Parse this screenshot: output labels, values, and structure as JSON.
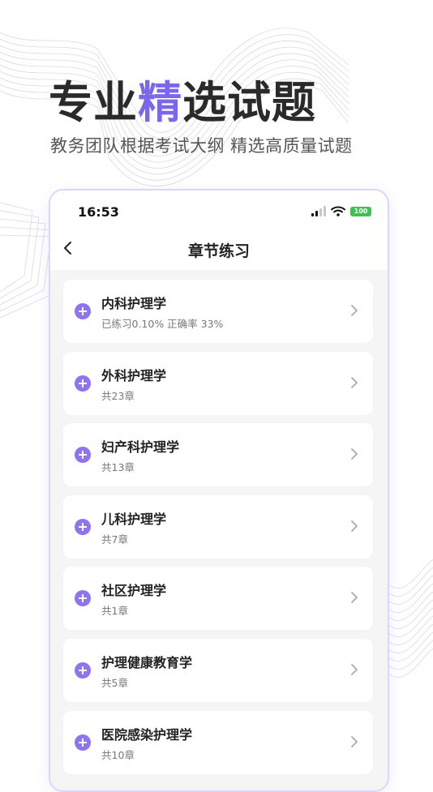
{
  "promo": {
    "title_part1": "专业",
    "title_accent": "精",
    "title_part2": "选试题",
    "subtitle": "教务团队根据考试大纲 精选高质量试题",
    "accent_color": "#7c66ee"
  },
  "status_bar": {
    "time": "16:53",
    "battery": "100"
  },
  "nav": {
    "back_icon": "chevron-left-icon",
    "title": "章节练习"
  },
  "chapters": [
    {
      "title": "内科护理学",
      "subtitle": "已练习0.10% 正确率 33%"
    },
    {
      "title": "外科护理学",
      "subtitle": "共23章"
    },
    {
      "title": "妇产科护理学",
      "subtitle": "共13章"
    },
    {
      "title": "儿科护理学",
      "subtitle": "共7章"
    },
    {
      "title": "社区护理学",
      "subtitle": "共1章"
    },
    {
      "title": "护理健康教育学",
      "subtitle": "共5章"
    },
    {
      "title": "医院感染护理学",
      "subtitle": "共10章"
    }
  ]
}
